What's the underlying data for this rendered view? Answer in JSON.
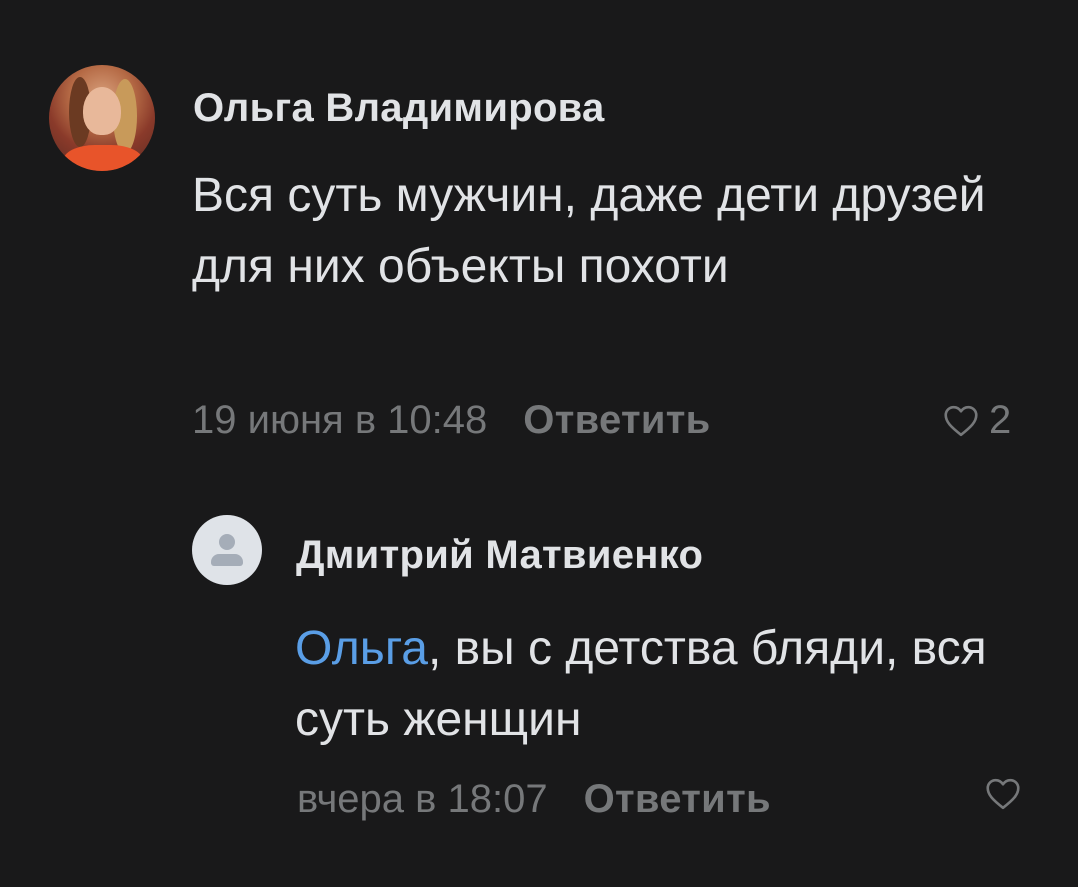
{
  "comments": [
    {
      "author": "Ольга Владимирова",
      "text": "Вся суть мужчин, даже дети друзей для них объекты похоти",
      "date": "19 июня в 10:48",
      "reply_label": "Ответить",
      "likes": "2",
      "avatar_icon": "user-photo"
    },
    {
      "author": "Дмитрий Матвиенко",
      "mention": "Ольга",
      "text": ", вы с детства бляди, вся суть женщин",
      "date": "вчера в 18:07",
      "reply_label": "Ответить",
      "likes": "",
      "avatar_icon": "default-user-icon"
    }
  ],
  "colors": {
    "background": "#19191a",
    "text": "#e1e3e6",
    "secondary": "#76787a",
    "mention": "#5a9ee6"
  }
}
